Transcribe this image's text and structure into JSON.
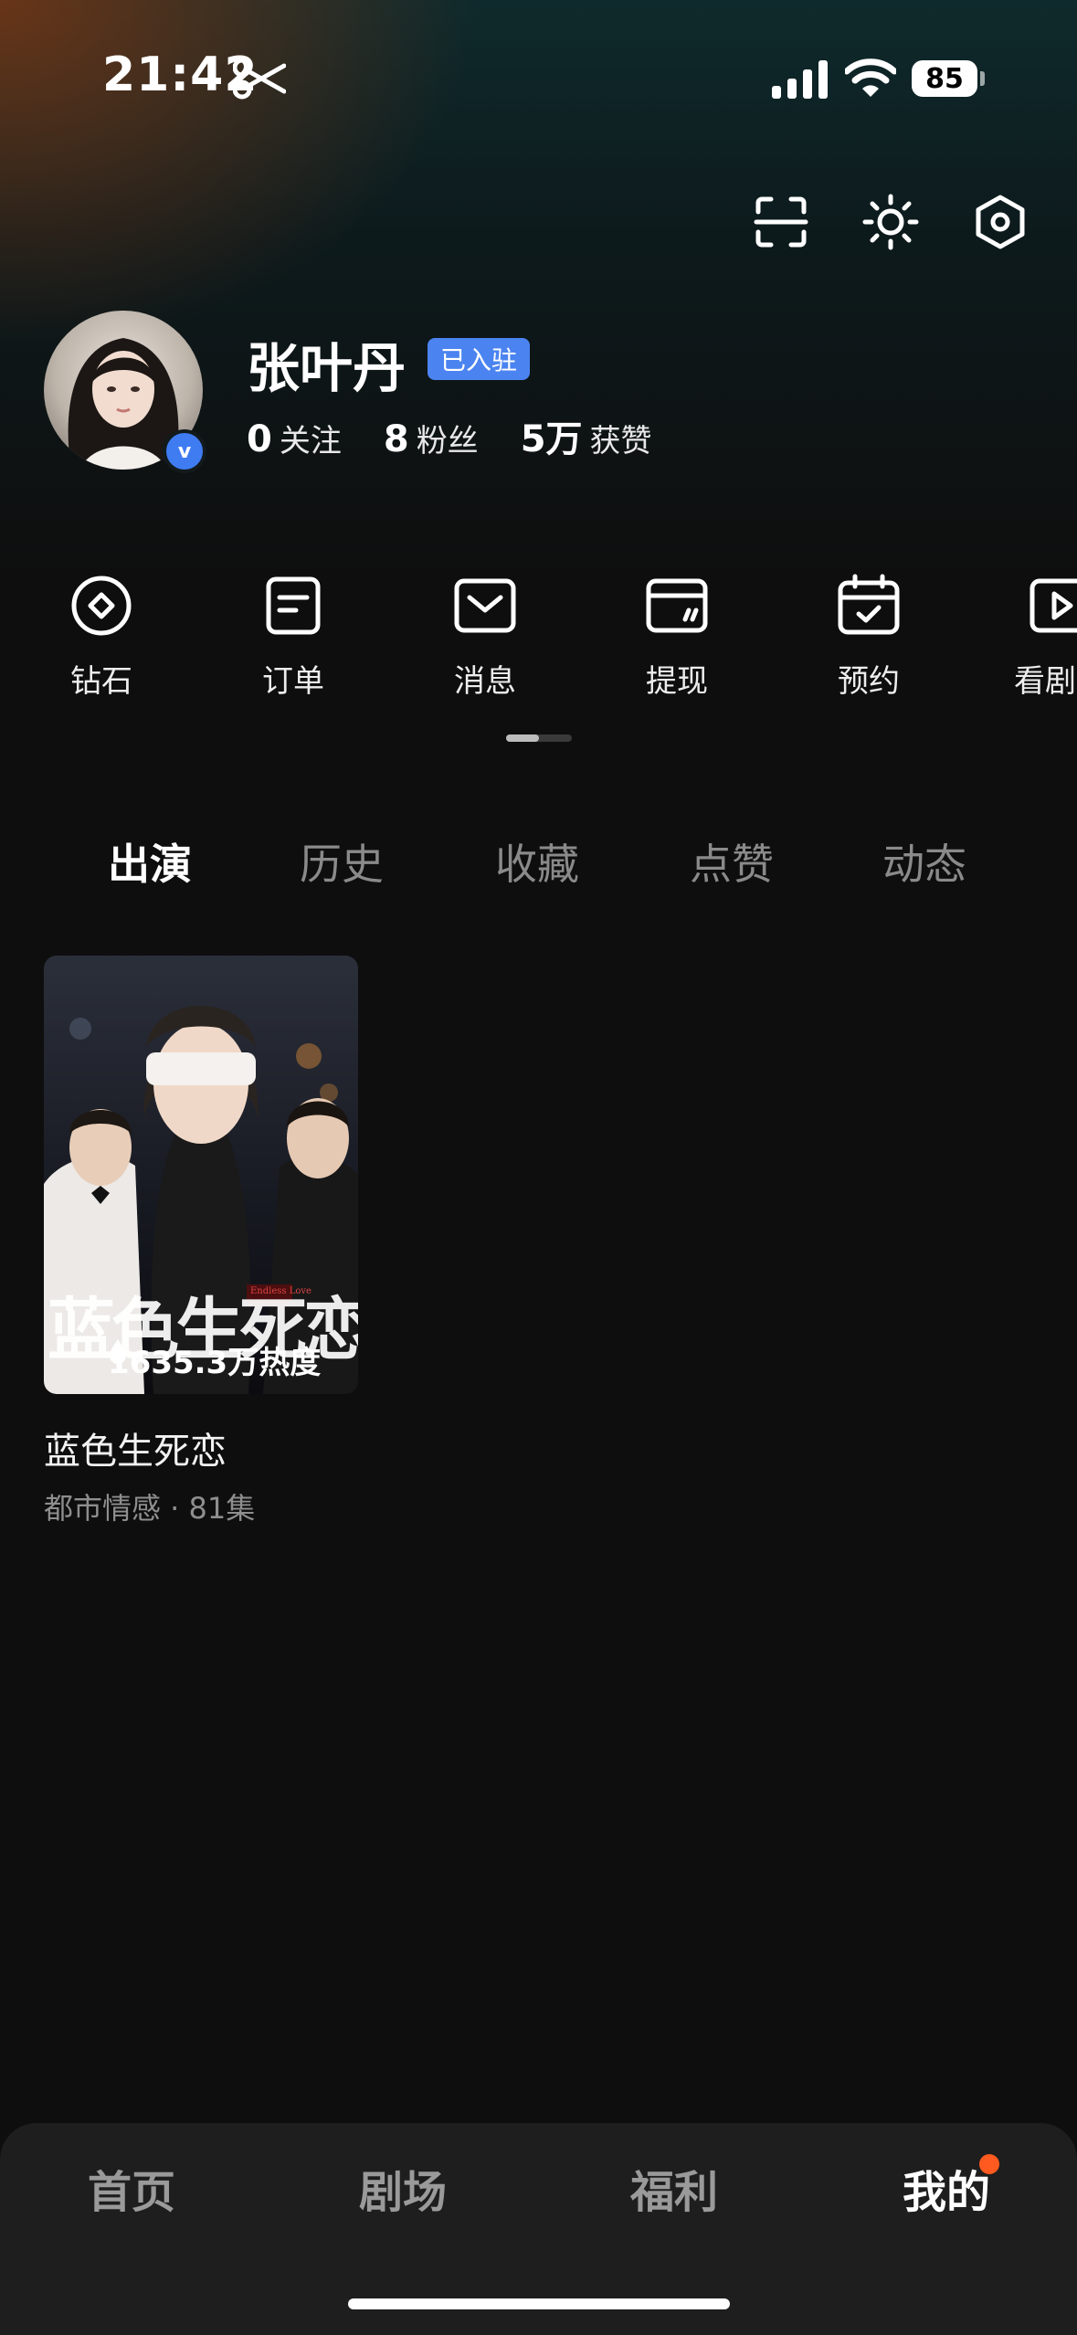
{
  "status_bar": {
    "time": "21:42",
    "battery": "85"
  },
  "top_icons": [
    "scan-icon",
    "brightness-icon",
    "settings-icon"
  ],
  "profile": {
    "name": "张叶丹",
    "badge": "已入驻",
    "verified_mark": "v",
    "stats": [
      {
        "value": "0",
        "label": "关注"
      },
      {
        "value": "8",
        "label": "粉丝"
      },
      {
        "value": "5万",
        "label": "获赞"
      }
    ]
  },
  "actions": [
    {
      "label": "钻石",
      "icon": "diamond-icon"
    },
    {
      "label": "订单",
      "icon": "order-icon"
    },
    {
      "label": "消息",
      "icon": "message-icon"
    },
    {
      "label": "提现",
      "icon": "wallet-icon"
    },
    {
      "label": "预约",
      "icon": "calendar-icon"
    },
    {
      "label": "看剧偏",
      "icon": "play-icon"
    }
  ],
  "tabs": [
    {
      "label": "出演",
      "active": true
    },
    {
      "label": "历史",
      "active": false
    },
    {
      "label": "收藏",
      "active": false
    },
    {
      "label": "点赞",
      "active": false
    },
    {
      "label": "动态",
      "active": false
    }
  ],
  "drama": {
    "poster_title": "蓝色生死恋",
    "poster_subtitle": "Endless Love",
    "heat": "1635.3万热度",
    "title": "蓝色生死恋",
    "meta": "都市情感 · 81集"
  },
  "bottom_nav": [
    {
      "label": "首页",
      "active": false
    },
    {
      "label": "剧场",
      "active": false
    },
    {
      "label": "福利",
      "active": false
    },
    {
      "label": "我的",
      "active": true
    }
  ],
  "colors": {
    "accent_blue": "#4b84f0",
    "notification_dot": "#ff5a1f",
    "background": "#0e0e0e"
  }
}
